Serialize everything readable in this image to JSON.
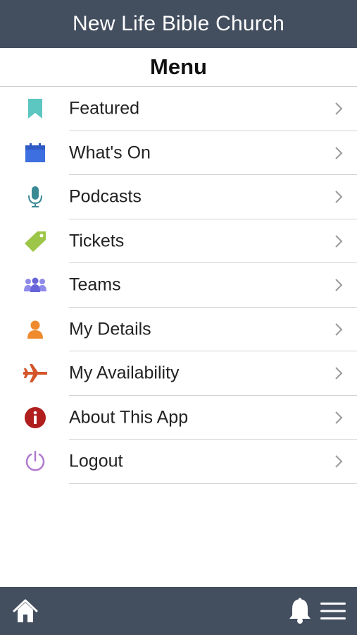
{
  "header": {
    "title": "New Life Bible Church"
  },
  "subheader": {
    "title": "Menu"
  },
  "menu": {
    "items": [
      {
        "label": "Featured",
        "icon": "bookmark-icon",
        "color": "#5cc6c0"
      },
      {
        "label": "What's On",
        "icon": "calendar-icon",
        "color": "#3d6fe0"
      },
      {
        "label": "Podcasts",
        "icon": "microphone-icon",
        "color": "#3a8a96"
      },
      {
        "label": "Tickets",
        "icon": "tag-icon",
        "color": "#9dc548"
      },
      {
        "label": "Teams",
        "icon": "group-icon",
        "color": "#7a76e4"
      },
      {
        "label": "My Details",
        "icon": "person-icon",
        "color": "#ef8a2d"
      },
      {
        "label": "My Availability",
        "icon": "airplane-icon",
        "color": "#d4552a"
      },
      {
        "label": "About This App",
        "icon": "info-icon",
        "color": "#b01e1e"
      },
      {
        "label": "Logout",
        "icon": "power-icon",
        "color": "#b07ad0"
      }
    ]
  },
  "footer": {
    "icons": [
      "home-icon",
      "bell-icon",
      "hamburger-menu-icon"
    ],
    "bar_color": "#434e5f"
  }
}
